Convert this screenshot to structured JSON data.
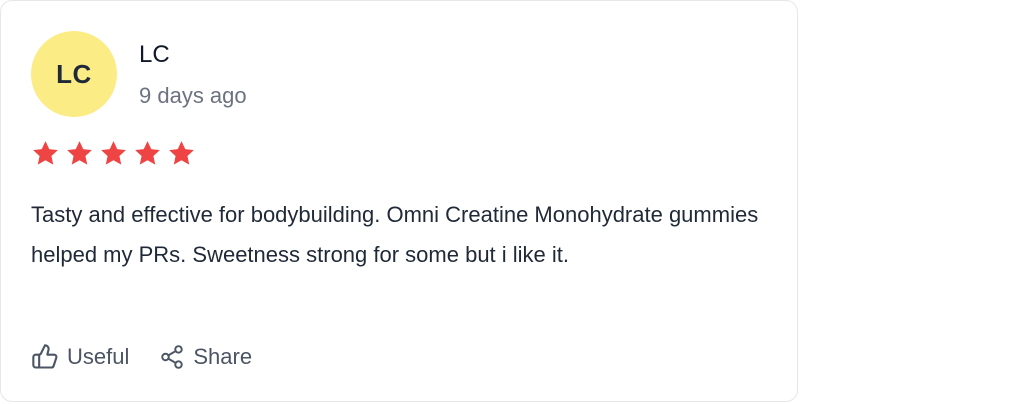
{
  "review": {
    "avatar_initials": "LC",
    "avatar_color": "#fcec86",
    "author": "LC",
    "date": "9 days ago",
    "rating": 5,
    "rating_max": 5,
    "star_color": "#ef4444",
    "text": "Tasty and effective for bodybuilding. Omni Creatine Monohydrate gummies helped my PRs. Sweetness strong for some but i like it."
  },
  "actions": {
    "useful_label": "Useful",
    "useful_icon": "thumbs-up-icon",
    "share_label": "Share",
    "share_icon": "share-icon"
  }
}
